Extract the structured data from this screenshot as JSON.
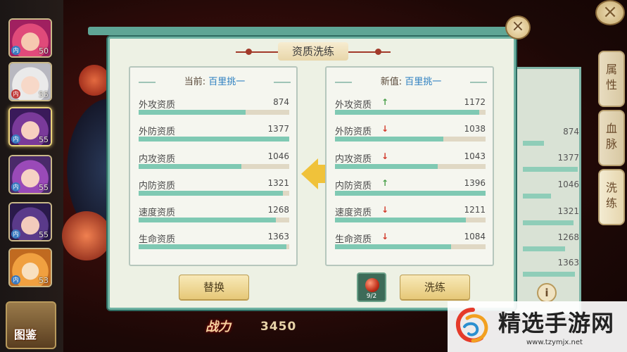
{
  "colors": {
    "accent_teal": "#6fb3a3",
    "bar_fill": "#7fc9b3",
    "bar_track": "#e0d8c4",
    "arrow_up": "#4aa04a",
    "arrow_down": "#d23a2a",
    "value_blue": "#2c7fc0"
  },
  "heroes": [
    {
      "level": "50",
      "icon": "hero-pink-hair-portrait",
      "tag": "内"
    },
    {
      "level": "55",
      "icon": "hero-white-hair-portrait",
      "tag": "内"
    },
    {
      "level": "55",
      "icon": "hero-purple-hair-portrait",
      "tag": "内",
      "selected": true
    },
    {
      "level": "55",
      "icon": "hero-purple-twin-portrait",
      "tag": "内"
    },
    {
      "level": "55",
      "icon": "hero-dark-hair-portrait",
      "tag": "内"
    },
    {
      "level": "53",
      "icon": "hero-fox-portrait",
      "tag": "内"
    }
  ],
  "tujian_label": "图鉴",
  "dialog": {
    "title": "资质洗练",
    "current": {
      "label": "当前:",
      "value": "百里挑一",
      "stats": [
        {
          "name": "外攻资质",
          "value": "874",
          "fill": 0.71
        },
        {
          "name": "外防资质",
          "value": "1377",
          "fill": 1.0
        },
        {
          "name": "内攻资质",
          "value": "1046",
          "fill": 0.68
        },
        {
          "name": "内防资质",
          "value": "1321",
          "fill": 0.96
        },
        {
          "name": "速度资质",
          "value": "1268",
          "fill": 0.91
        },
        {
          "name": "生命资质",
          "value": "1363",
          "fill": 0.98
        }
      ]
    },
    "new": {
      "label": "新值:",
      "value": "百里挑一",
      "stats": [
        {
          "name": "外攻资质",
          "value": "1172",
          "dir": "up",
          "fill": 0.96
        },
        {
          "name": "外防资质",
          "value": "1038",
          "dir": "down",
          "fill": 0.72
        },
        {
          "name": "内攻资质",
          "value": "1043",
          "dir": "down",
          "fill": 0.68
        },
        {
          "name": "内防资质",
          "value": "1396",
          "dir": "up",
          "fill": 1.0
        },
        {
          "name": "速度资质",
          "value": "1211",
          "dir": "down",
          "fill": 0.87
        },
        {
          "name": "生命资质",
          "value": "1084",
          "dir": "down",
          "fill": 0.77
        }
      ]
    },
    "replace_button": "替换",
    "refine_button": "洗练",
    "item_count": "9/2"
  },
  "right_tabs": [
    "属性",
    "血脉",
    "洗练"
  ],
  "bg_values": [
    "874",
    "1377",
    "1046",
    "1321",
    "1268",
    "1363"
  ],
  "power_label": "战力",
  "power_value": "3450",
  "watermark": {
    "name": "精选手游网",
    "url": "www.tzymjx.net"
  }
}
